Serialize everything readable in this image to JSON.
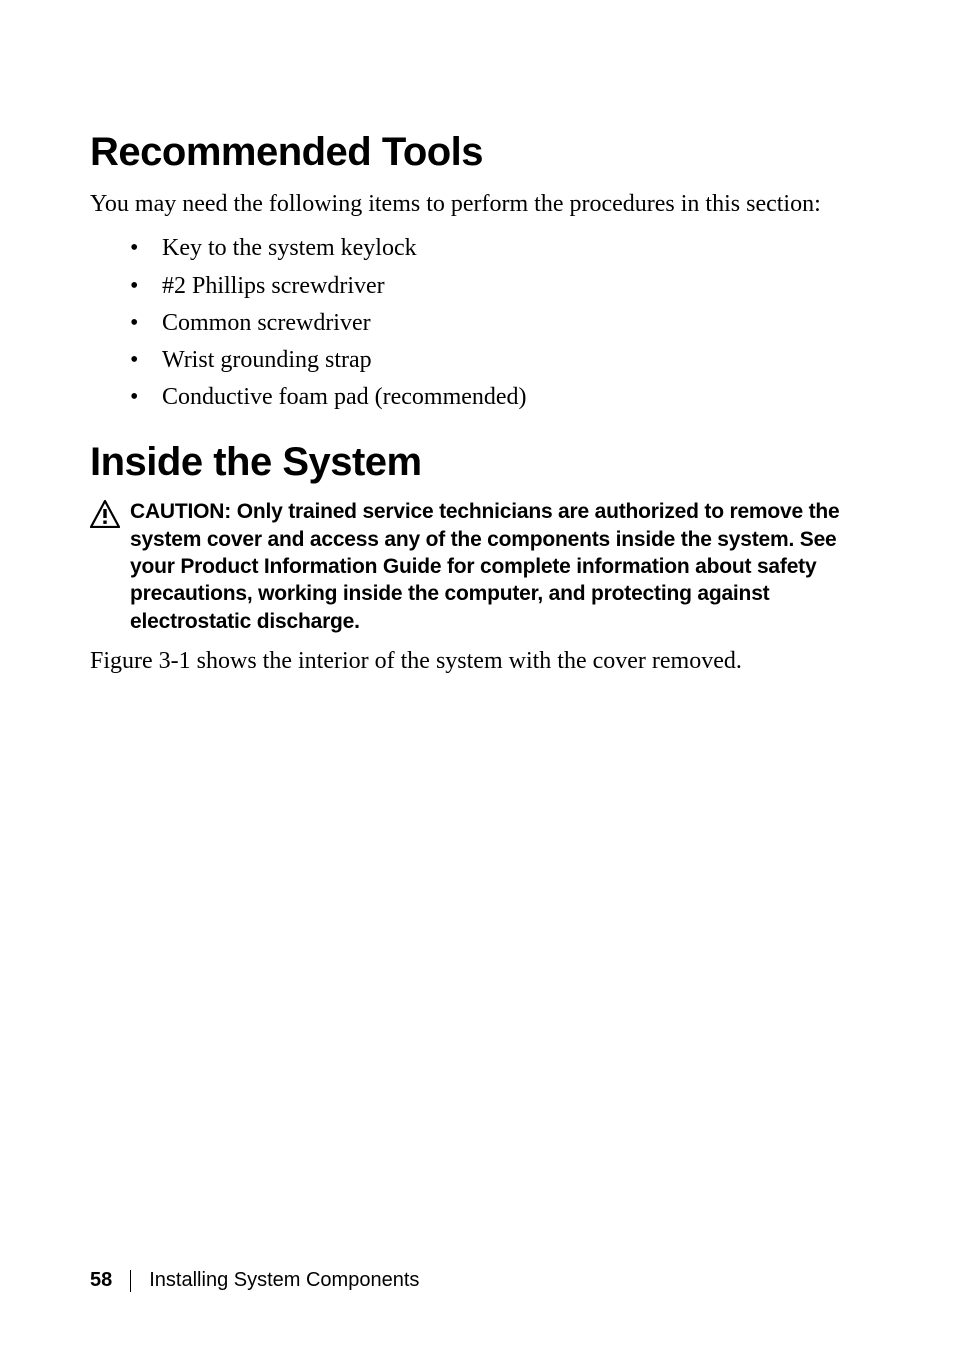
{
  "headings": {
    "recommended_tools": "Recommended Tools",
    "inside_system": "Inside the System"
  },
  "intro_text": "You may need the following items to perform the procedures in this section:",
  "tools": [
    "Key to the system keylock",
    "#2 Phillips screwdriver",
    "Common screwdriver",
    "Wrist grounding strap",
    "Conductive foam pad (recommended)"
  ],
  "caution": {
    "label": "CAUTION: ",
    "body": "Only trained service technicians are authorized to remove the system cover and access any of the components inside the system. See your Product Information Guide for complete information about safety precautions, working inside the computer, and protecting against electrostatic discharge."
  },
  "figure_line": "Figure 3-1 shows the interior of the system with the cover removed.",
  "footer": {
    "page_number": "58",
    "section_title": "Installing System Components"
  }
}
